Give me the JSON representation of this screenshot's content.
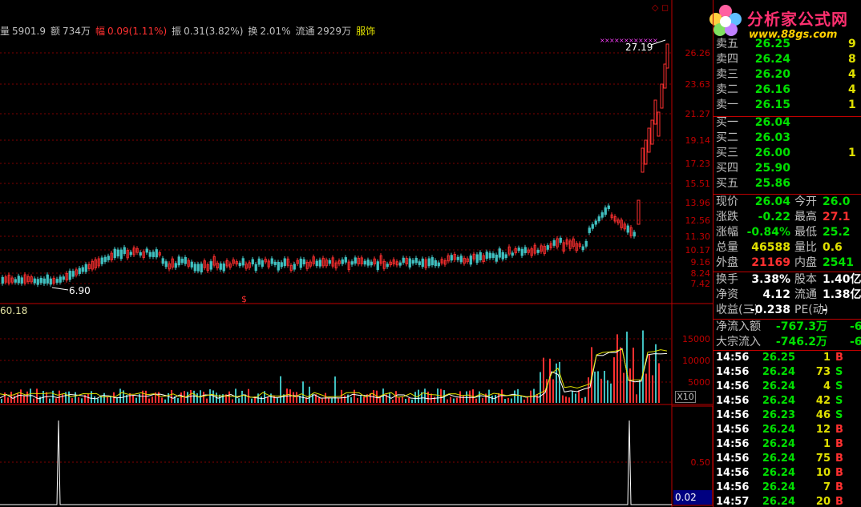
{
  "info_bar": {
    "volume_label": "量",
    "volume_value": "5901.9",
    "amount_label": "额",
    "amount_value": "734万",
    "change_label": "幅",
    "change_value": "0.09(1.11%)",
    "amplitude_label": "振",
    "amplitude_value": "0.31(3.82%)",
    "turnover_label": "换",
    "turnover_value": "2.01%",
    "float_label": "流通",
    "float_value": "2929万",
    "sector": "服饰"
  },
  "logo": {
    "title": "分析家公式网",
    "url": "www.88gs.com"
  },
  "price_axis": [
    "26.26",
    "23.63",
    "21.27",
    "19.14",
    "17.23",
    "15.51",
    "13.96",
    "12.56",
    "11.30",
    "10.17",
    "9.16",
    "8.24",
    "7.42"
  ],
  "volume_axis": [
    "15000",
    "10000",
    "5000"
  ],
  "volume_multiplier": "X10",
  "indicator_axis": [
    "0.50"
  ],
  "indicator_value": "0.02",
  "volume_indicator_value": "60.18",
  "chart_labels": {
    "high_price": "27.19",
    "low_price": "6.90",
    "marker": "$"
  },
  "order_book": {
    "sell": [
      {
        "label": "卖五",
        "price": "26.25",
        "vol": "9"
      },
      {
        "label": "卖四",
        "price": "26.24",
        "vol": "8"
      },
      {
        "label": "卖三",
        "price": "26.20",
        "vol": "4"
      },
      {
        "label": "卖二",
        "price": "26.16",
        "vol": "4"
      },
      {
        "label": "卖一",
        "price": "26.15",
        "vol": "1"
      }
    ],
    "buy": [
      {
        "label": "买一",
        "price": "26.04",
        "vol": ""
      },
      {
        "label": "买二",
        "price": "26.03",
        "vol": ""
      },
      {
        "label": "买三",
        "price": "26.00",
        "vol": "1"
      },
      {
        "label": "买四",
        "price": "25.90",
        "vol": ""
      },
      {
        "label": "买五",
        "price": "25.86",
        "vol": ""
      }
    ]
  },
  "quote": [
    {
      "l1": "现价",
      "v1": "26.04",
      "l2": "今开",
      "v2": "26.0"
    },
    {
      "l1": "涨跌",
      "v1": "-0.22",
      "l2": "最高",
      "v2": "27.1"
    },
    {
      "l1": "涨幅",
      "v1": "-0.84%",
      "l2": "最低",
      "v2": "25.2"
    },
    {
      "l1": "总量",
      "v1": "46588",
      "l2": "量比",
      "v2": "0.6"
    },
    {
      "l1": "外盘",
      "v1": "21169",
      "l2": "内盘",
      "v2": "2541"
    }
  ],
  "stats": [
    {
      "l1": "换手",
      "v1": "3.38%",
      "l2": "股本",
      "v2": "1.40亿"
    },
    {
      "l1": "净资",
      "v1": "4.12",
      "l2": "流通",
      "v2": "1.38亿"
    },
    {
      "l1": "收益(三)",
      "v1": "-0.238",
      "l2": "PE(动)",
      "v2": "-"
    }
  ],
  "flows": [
    {
      "label": "净流入额",
      "value": "-767.3万",
      "pct": "-6"
    },
    {
      "label": "大宗流入",
      "value": "-746.2万",
      "pct": "-6"
    }
  ],
  "ticks": [
    {
      "time": "14:56",
      "price": "26.25",
      "vol": "1",
      "dir": "B"
    },
    {
      "time": "14:56",
      "price": "26.24",
      "vol": "73",
      "dir": "S"
    },
    {
      "time": "14:56",
      "price": "26.24",
      "vol": "4",
      "dir": "S"
    },
    {
      "time": "14:56",
      "price": "26.24",
      "vol": "42",
      "dir": "S"
    },
    {
      "time": "14:56",
      "price": "26.23",
      "vol": "46",
      "dir": "S"
    },
    {
      "time": "14:56",
      "price": "26.24",
      "vol": "12",
      "dir": "B"
    },
    {
      "time": "14:56",
      "price": "26.24",
      "vol": "1",
      "dir": "B"
    },
    {
      "time": "14:56",
      "price": "26.24",
      "vol": "75",
      "dir": "B"
    },
    {
      "time": "14:56",
      "price": "26.24",
      "vol": "10",
      "dir": "B"
    },
    {
      "time": "14:56",
      "price": "26.24",
      "vol": "7",
      "dir": "B"
    },
    {
      "time": "14:57",
      "price": "26.24",
      "vol": "20",
      "dir": "B"
    }
  ]
}
